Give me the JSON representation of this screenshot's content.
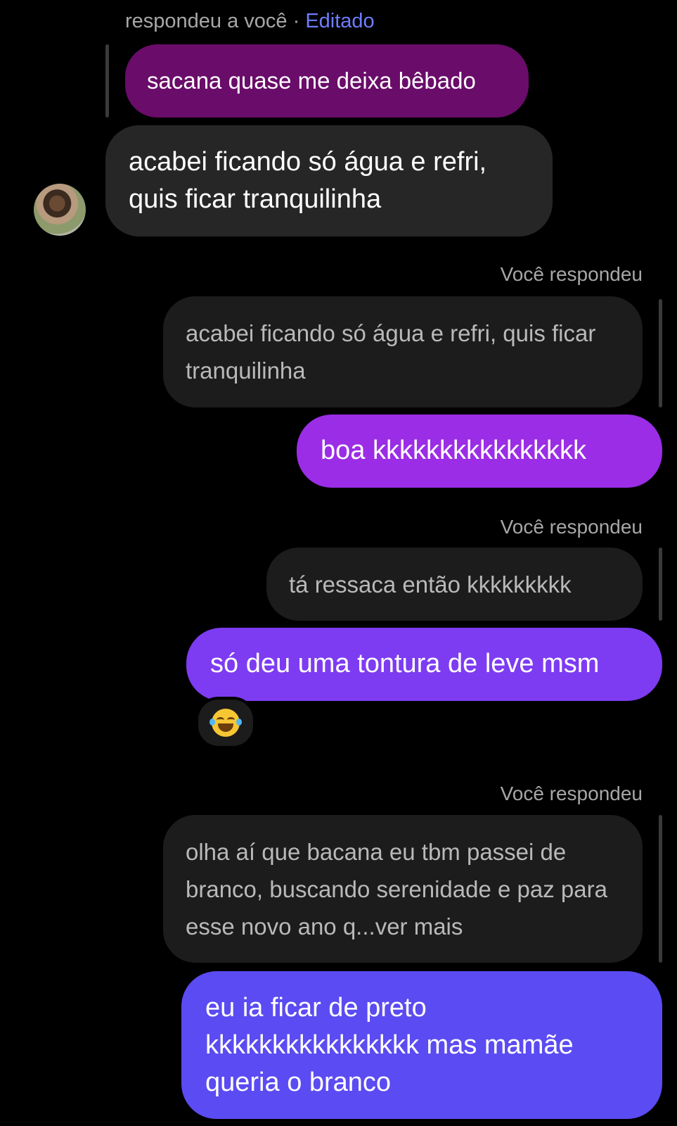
{
  "header": {
    "replied_to_you": "respondeu a você · ",
    "edited": "Editado"
  },
  "messages": {
    "quoted_top": "sacana quase me deixa bêbado",
    "incoming_1_line1": "acabei ficando só água e refri,",
    "incoming_1_line2": "quis ficar tranquilinha",
    "you_replied_1": "Você respondeu",
    "quote_1": "acabei ficando só água e refri, quis ficar tranquilinha",
    "out_1": "boa kkkkkkkkkkkkkkkk",
    "you_replied_2": "Você respondeu",
    "quote_2": "tá ressaca então kkkkkkkkk",
    "out_2": "só deu uma tontura de leve msm",
    "reaction": "grinning-tears-emoji",
    "you_replied_3": "Você respondeu",
    "quote_3": "olha aí que bacana eu tbm passei de branco, buscando serenidade e paz para esse novo ano q...ver mais",
    "out_3": "eu ia ficar de preto kkkkkkkkkkkkkkkk mas mamãe queria o branco"
  },
  "colors": {
    "background": "#000000",
    "quoted_top": "#6a0c6a",
    "incoming": "#262626",
    "quoted": "#1c1c1c",
    "out_1": "#9b2de6",
    "out_2": "#7d3cf2",
    "out_3": "#5b4bf2",
    "edited_link": "#6e7cff"
  }
}
